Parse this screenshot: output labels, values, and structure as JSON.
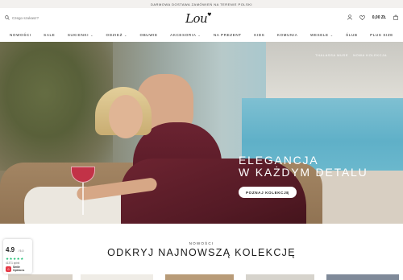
{
  "announcement": "DARMOWA DOSTAWA ZAMÓWIEŃ NA TERENIE POLSKI",
  "header": {
    "search_placeholder": "Czego szukasz?",
    "logo_text": "Lou",
    "cart_total": "0,00 ZŁ"
  },
  "nav": {
    "items": [
      {
        "label": "NOWOŚCI",
        "dropdown": false
      },
      {
        "label": "SALE",
        "dropdown": false
      },
      {
        "label": "SUKIENKI",
        "dropdown": true
      },
      {
        "label": "ODZIEŻ",
        "dropdown": true
      },
      {
        "label": "OBUWIE",
        "dropdown": false
      },
      {
        "label": "AKCESORIA",
        "dropdown": true
      },
      {
        "label": "NA PREZENT",
        "dropdown": false
      },
      {
        "label": "KIDS",
        "dropdown": false
      },
      {
        "label": "KOMUNIA",
        "dropdown": false
      },
      {
        "label": "WESELE",
        "dropdown": true
      },
      {
        "label": "ŚLUB",
        "dropdown": false
      },
      {
        "label": "PLUS SIZE",
        "dropdown": false
      }
    ]
  },
  "hero": {
    "breadcrumbs": [
      "THALASSA MUSE",
      "NOWA KOLEKCJA"
    ],
    "title_line1": "ELEGANCJA",
    "title_line2": "W KAŻDYM DETALU",
    "cta_label": "POZNAJ KOLEKCJĘ"
  },
  "section": {
    "eyebrow": "NOWOŚCI",
    "title": "ODKRYJ NAJNOWSZĄ KOLEKCJĘ"
  },
  "rating_widget": {
    "score": "4.9",
    "max": "/ 5.0",
    "stars": 5,
    "count": "41371 opinii",
    "brand_line1": "Smile",
    "brand_line2": "Opinions"
  },
  "colors": {
    "accent": "#1a1a1a",
    "star": "#1dbf73",
    "hero_dress": "#6d2431"
  }
}
